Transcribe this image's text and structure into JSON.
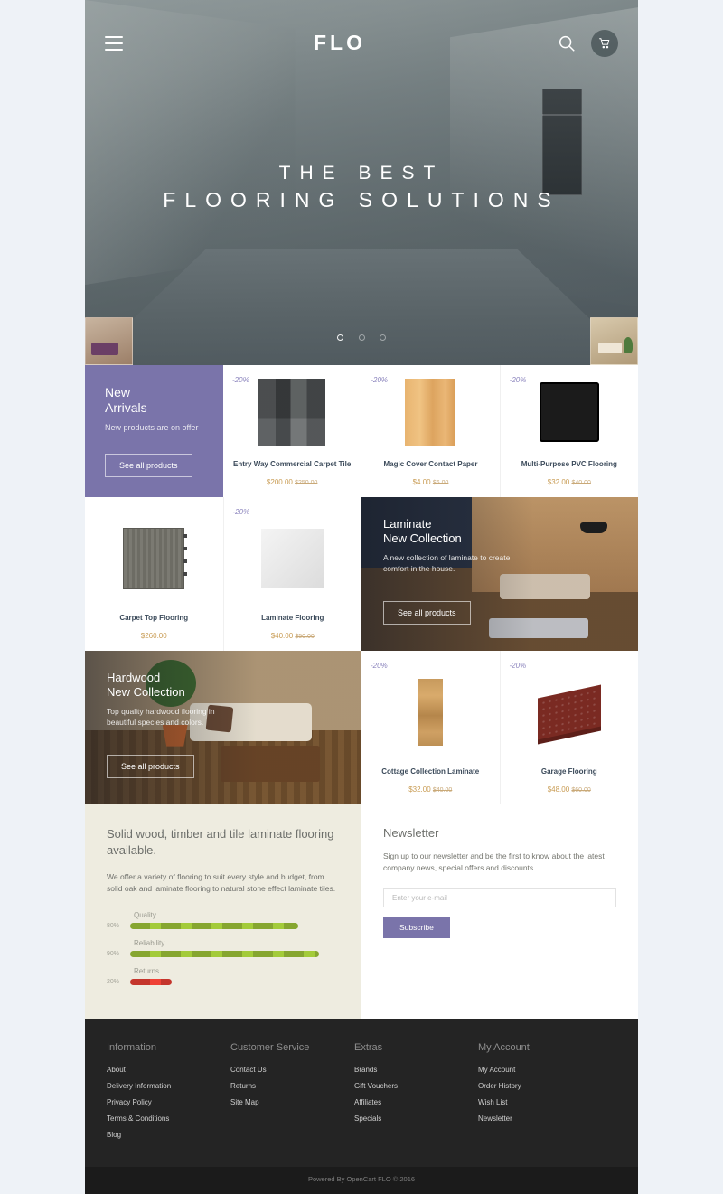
{
  "header": {
    "logo": "FLO",
    "menu_icon": "hamburger-icon",
    "search_icon": "search-icon",
    "cart_icon": "cart-icon"
  },
  "hero": {
    "title_line1": "THE BEST",
    "title_line2": "FLOORING SOLUTIONS",
    "slide_count": 3,
    "active_slide": 1
  },
  "new_arrivals": {
    "title_line1": "New",
    "title_line2": "Arrivals",
    "subtitle": "New products are on offer",
    "button": "See all products",
    "bg_color": "#7a74aa"
  },
  "products_row1": [
    {
      "badge": "-20%",
      "name": "Entry Way Commercial Carpet Tile",
      "price": "$200.00",
      "old_price": "$250.00"
    },
    {
      "badge": "-20%",
      "name": "Magic Cover Contact Paper",
      "price": "$4.00",
      "old_price": "$6.00"
    },
    {
      "badge": "-20%",
      "name": "Multi-Purpose PVC Flooring",
      "price": "$32.00",
      "old_price": "$40.00"
    }
  ],
  "products_row2": [
    {
      "badge": "",
      "name": "Carpet Top Flooring",
      "price": "$260.00",
      "old_price": ""
    },
    {
      "badge": "-20%",
      "name": "Laminate Flooring",
      "price": "$40.00",
      "old_price": "$50.00"
    }
  ],
  "products_row3": [
    {
      "badge": "-20%",
      "name": "Cottage Collection Laminate",
      "price": "$32.00",
      "old_price": "$40.00"
    },
    {
      "badge": "-20%",
      "name": "Garage Flooring",
      "price": "$48.00",
      "old_price": "$60.00"
    }
  ],
  "banner_laminate": {
    "title_line1": "Laminate",
    "title_line2": "New Collection",
    "text": "A new collection of laminate to create comfort in the house.",
    "button": "See all products"
  },
  "banner_hardwood": {
    "title_line1": "Hardwood",
    "title_line2": "New Collection",
    "text": "Top quality hardwood flooring in beautiful species and colors.",
    "button": "See all products"
  },
  "info": {
    "heading": "Solid wood, timber and tile laminate flooring available.",
    "lead": "We offer a variety of flooring to suit every style and budget, from solid oak and laminate flooring to natural stone effect laminate tiles.",
    "bars": [
      {
        "label": "Quality",
        "pct": "80%",
        "value": 80,
        "color": "#a3cb3a"
      },
      {
        "label": "Reliability",
        "pct": "90%",
        "value": 90,
        "color": "#a3cb3a"
      },
      {
        "label": "Returns",
        "pct": "20%",
        "value": 20,
        "color": "#ef4136"
      }
    ]
  },
  "newsletter": {
    "heading": "Newsletter",
    "text": "Sign up to our newsletter and be the first to know about the latest company news, special offers and discounts.",
    "placeholder": "Enter your e-mail",
    "button": "Subscribe"
  },
  "footer": {
    "columns": [
      {
        "title": "Information",
        "links": [
          "About",
          "Delivery Information",
          "Privacy Policy",
          "Terms & Conditions",
          "Blog"
        ]
      },
      {
        "title": "Customer Service",
        "links": [
          "Contact Us",
          "Returns",
          "Site Map"
        ]
      },
      {
        "title": "Extras",
        "links": [
          "Brands",
          "Gift Vouchers",
          "Affiliates",
          "Specials"
        ]
      },
      {
        "title": "My Account",
        "links": [
          "My Account",
          "Order History",
          "Wish List",
          "Newsletter"
        ]
      }
    ],
    "copyright": "Powered By OpenCart FLO © 2016"
  }
}
